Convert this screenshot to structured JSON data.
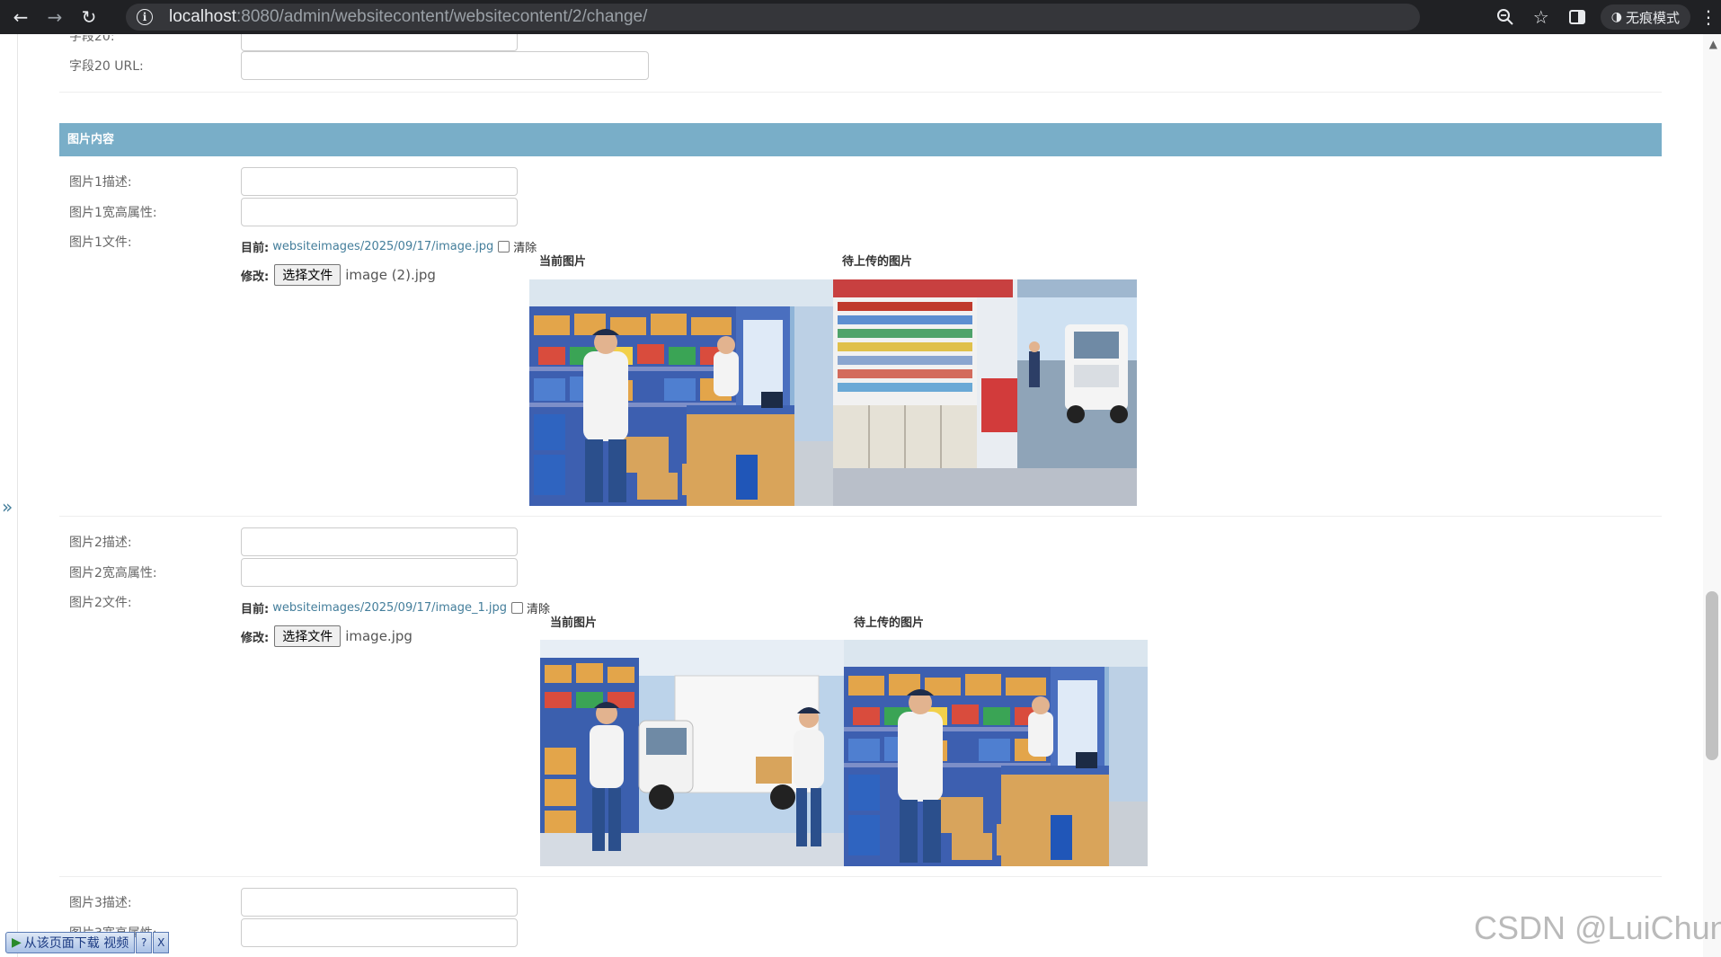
{
  "browser": {
    "url_host": "localhost",
    "url_rest": ":8080/admin/websitecontent/websitecontent/2/change/",
    "incognito_label": "无痕模式"
  },
  "field20": {
    "label_partial": "字段20:",
    "url_label": "字段20 URL:"
  },
  "section": {
    "title": "图片内容"
  },
  "images": [
    {
      "desc_label": "图片1描述:",
      "size_label": "图片1宽高属性:",
      "file_label": "图片1文件:",
      "current_label": "目前:",
      "current_path": "websiteimages/2025/09/17/image.jpg",
      "clear_label": "清除",
      "change_label": "修改:",
      "choose_button": "选择文件",
      "chosen_file": "image (2).jpg",
      "current_title": "当前图片",
      "pending_title": "待上传的图片"
    },
    {
      "desc_label": "图片2描述:",
      "size_label": "图片2宽高属性:",
      "file_label": "图片2文件:",
      "current_label": "目前:",
      "current_path": "websiteimages/2025/09/17/image_1.jpg",
      "clear_label": "清除",
      "change_label": "修改:",
      "choose_button": "选择文件",
      "chosen_file": "image.jpg",
      "current_title": "当前图片",
      "pending_title": "待上传的图片"
    },
    {
      "desc_label": "图片3描述:",
      "size_label_partial": "图片3宽高属性:"
    }
  ],
  "download_bar": {
    "label": "从该页面下载 视频",
    "help": "?",
    "close": "X"
  },
  "watermark": "CSDN @LuiChun",
  "colors": {
    "module_header": "#79aec8",
    "link": "#447e9b",
    "chrome_bg": "#202124"
  }
}
